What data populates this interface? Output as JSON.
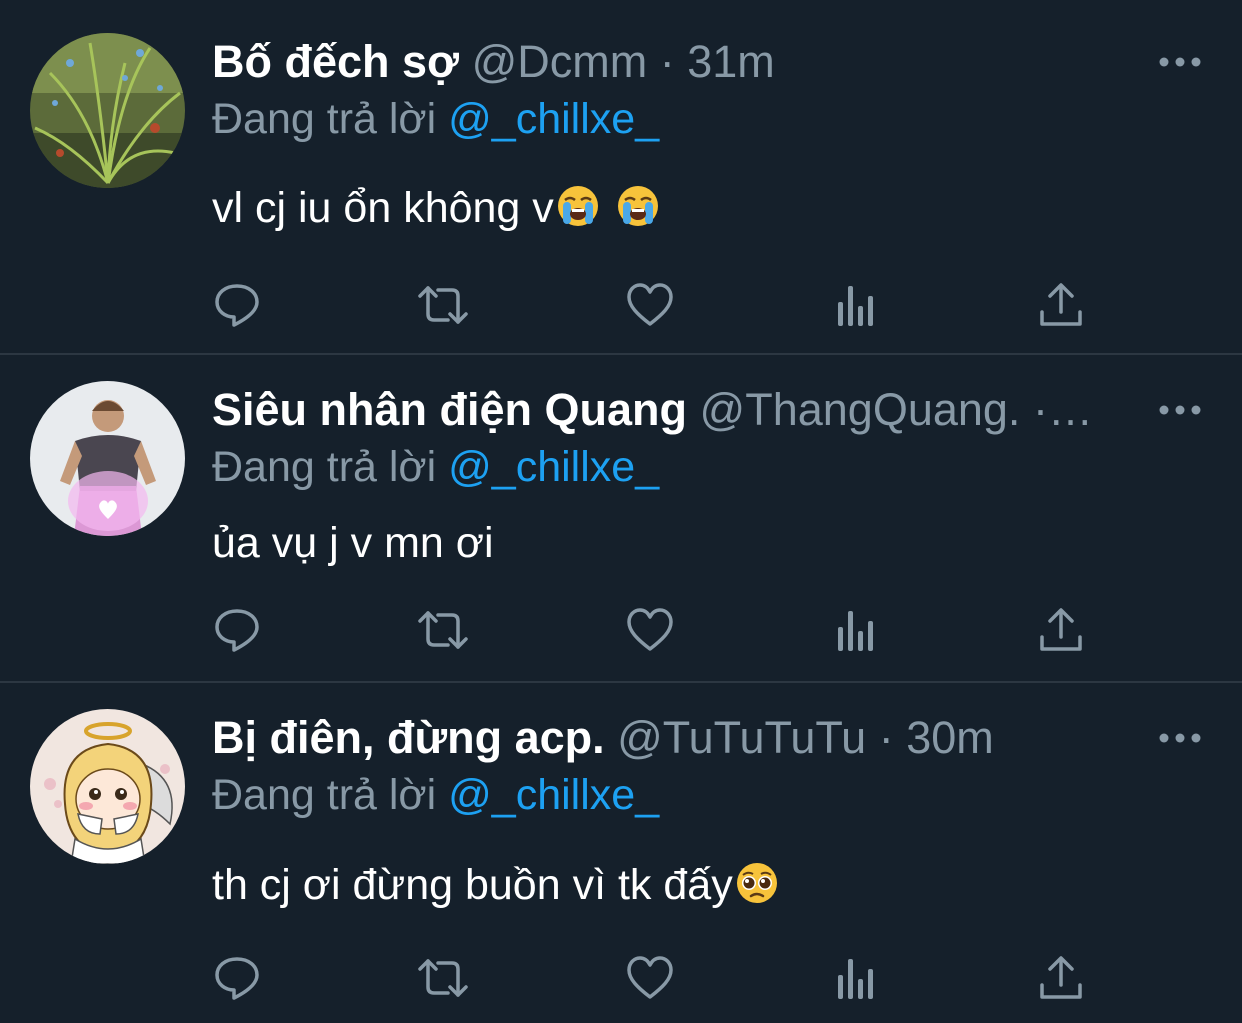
{
  "tweets": [
    {
      "name": "Bố đếch sợ",
      "handle": "@Dcmm",
      "dot": "·",
      "time": "31m",
      "reply_prefix": "Đang trả lời",
      "reply_user": "@_chillxe_",
      "text": "vl cj iu ổn không v",
      "emojis": [
        "loudly-crying-face",
        "loudly-crying-face"
      ],
      "avatar": "plant-photo"
    },
    {
      "name": "Siêu nhân điện Quang",
      "handle": "@ThangQuang.",
      "dot": "·…",
      "time": "",
      "reply_prefix": "Đang trả lời",
      "reply_user": "@_chillxe_",
      "text": "ủa vụ j v mn ơi",
      "emojis": [],
      "avatar": "man-heart-hands-photo"
    },
    {
      "name": "Bị điên, đừng acp.",
      "handle": "@TuTuTuTu",
      "dot": "·",
      "time": "30m",
      "reply_prefix": "Đang trả lời",
      "reply_user": "@_chillxe_",
      "text": "th cj ơi đừng buồn vì tk đấy",
      "emojis": [
        "pleading-face"
      ],
      "avatar": "anime-girl-drawing"
    }
  ],
  "icons": {
    "more": "more-horizontal-icon",
    "reply": "reply-icon",
    "retweet": "retweet-icon",
    "like": "like-icon",
    "analytics": "analytics-icon",
    "share": "share-icon"
  },
  "colors": {
    "background": "#15202b",
    "secondary_text": "#8899a6",
    "link": "#1da1f2",
    "divider": "#2c3742"
  }
}
